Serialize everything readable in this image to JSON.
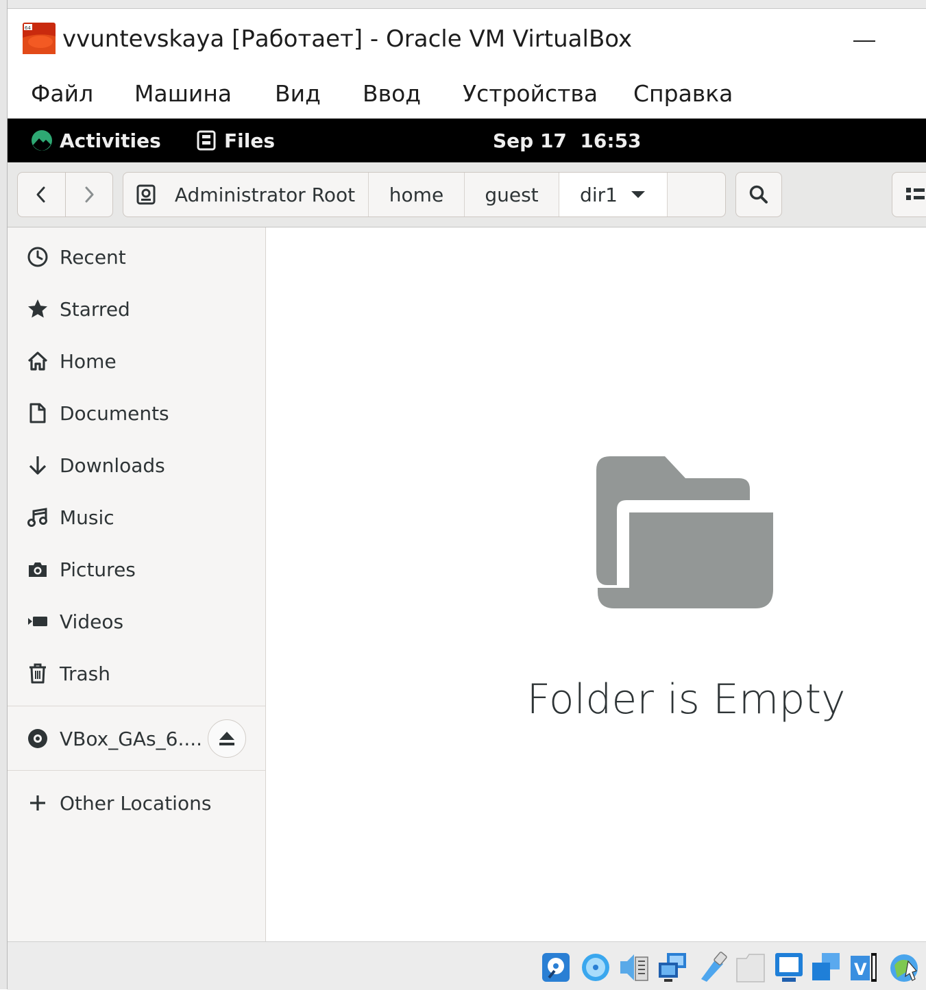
{
  "window": {
    "title": "vvuntevskaya [Работает] - Oracle VM VirtualBox"
  },
  "host_menu": [
    "Файл",
    "Машина",
    "Вид",
    "Ввод",
    "Устройства",
    "Справка"
  ],
  "topbar": {
    "activities": "Activities",
    "app_name": "Files",
    "clock": "Sep 17  16:53"
  },
  "pathbar": {
    "root_label": "Administrator Root",
    "segments": [
      "home",
      "guest",
      "dir1"
    ]
  },
  "sidebar": {
    "places": [
      "Recent",
      "Starred",
      "Home",
      "Documents",
      "Downloads",
      "Music",
      "Pictures",
      "Videos",
      "Trash"
    ],
    "device": "VBox_GAs_6....",
    "other": "Other Locations"
  },
  "main": {
    "empty_message": "Folder is Empty"
  },
  "colors": {
    "topbar_bg": "#000000",
    "sidebar_bg": "#f6f5f4",
    "folder_icon": "#939796",
    "headerbar_bg": "#e8e8e7",
    "activities_logo": "#2ea873"
  },
  "icons": {
    "sidebar": [
      "clock-icon",
      "star-icon",
      "home-icon",
      "document-icon",
      "download-arrow-icon",
      "music-note-icon",
      "camera-icon",
      "video-icon",
      "trash-icon"
    ],
    "tray": [
      "hard-disk-icon",
      "optical-disc-icon",
      "audio-icon",
      "network-icon",
      "usb-icon",
      "shared-folder-icon",
      "display-icon",
      "drag-drop-icon",
      "recording-icon",
      "mouse-integration-icon"
    ]
  }
}
